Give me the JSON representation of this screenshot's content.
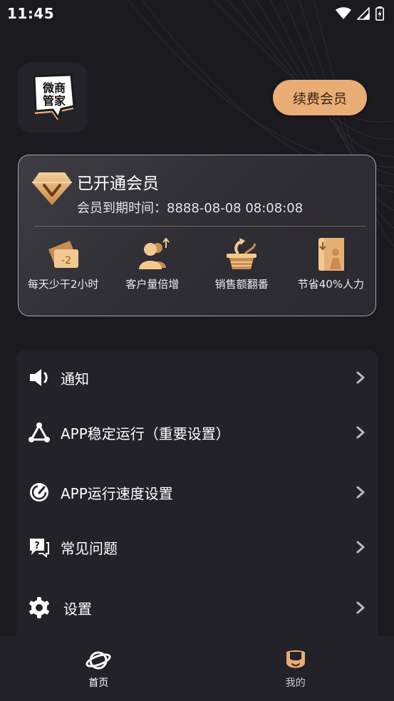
{
  "status_bar": {
    "time": "11:45"
  },
  "app": {
    "logo_text": [
      "微商",
      "管家"
    ],
    "renew_button": "续费会员"
  },
  "vip": {
    "title": "已开通会员",
    "expire_label": "会员到期时间：",
    "expire_value": "8888-08-08 08:08:08",
    "benefits": [
      {
        "label": "每天少干2小时",
        "icon": "time-ticket-icon",
        "badge": "-2"
      },
      {
        "label": "客户量倍增",
        "icon": "customers-up-icon"
      },
      {
        "label": "销售额翻番",
        "icon": "sales-basket-icon"
      },
      {
        "label": "节省40%人力",
        "icon": "manpower-door-icon"
      }
    ]
  },
  "menu": [
    {
      "label": "通知",
      "icon": "speaker-icon"
    },
    {
      "label": "APP稳定运行（重要设置）",
      "icon": "network-icon"
    },
    {
      "label": "APP运行速度设置",
      "icon": "speedometer-icon"
    },
    {
      "label": "常见问题",
      "icon": "question-chat-icon"
    },
    {
      "label": "设置",
      "icon": "gear-icon"
    }
  ],
  "tabs": [
    {
      "label": "首页",
      "icon": "planet-icon",
      "active": true
    },
    {
      "label": "我的",
      "icon": "face-icon",
      "active": false
    }
  ],
  "colors": {
    "accent": "#e9ad76",
    "background": "#1b1a1f",
    "card": "#232228"
  }
}
